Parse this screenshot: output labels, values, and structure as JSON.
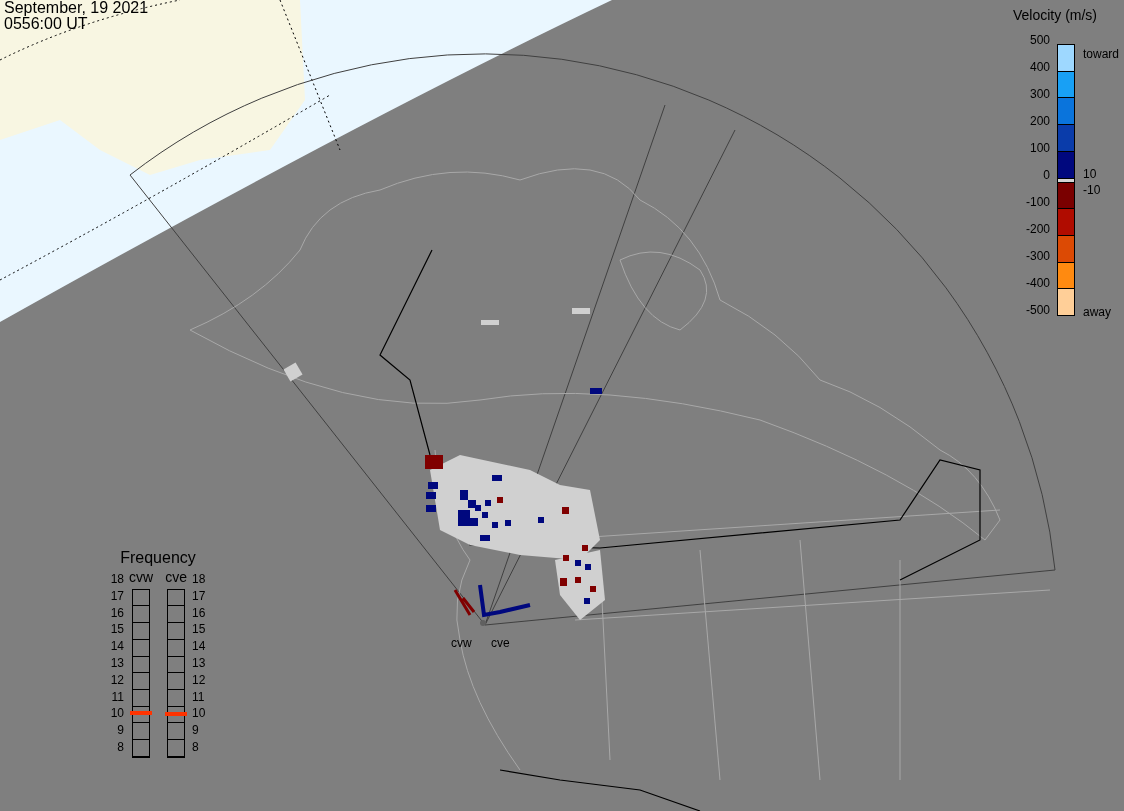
{
  "header": {
    "date": "September, 19 2021",
    "time": "0556:00 UT"
  },
  "velocity_legend": {
    "title": "Velocity (m/s)",
    "ticks": [
      "500",
      "400",
      "300",
      "200",
      "100",
      "0",
      "-100",
      "-200",
      "-300",
      "-400",
      "-500"
    ],
    "bands": [
      {
        "kind": "band",
        "color": "#9ed8ff"
      },
      {
        "kind": "band",
        "color": "#18a0f5"
      },
      {
        "kind": "band",
        "color": "#0a74dc"
      },
      {
        "kind": "band",
        "color": "#0a3caa"
      },
      {
        "kind": "band",
        "color": "#00087e"
      },
      {
        "kind": "zero",
        "color": "#d4d4d4"
      },
      {
        "kind": "band",
        "color": "#7a0000"
      },
      {
        "kind": "band",
        "color": "#b00c00"
      },
      {
        "kind": "band",
        "color": "#dc4a04"
      },
      {
        "kind": "band",
        "color": "#ff8a10"
      },
      {
        "kind": "band",
        "color": "#ffcf98"
      }
    ],
    "top_label": "toward",
    "upper_threshold": "10",
    "lower_threshold": "-10",
    "bottom_label": "away"
  },
  "frequency": {
    "title": "Frequency",
    "radars": [
      {
        "name": "cvw",
        "kind": "left",
        "scale": [
          "18",
          "17",
          "16",
          "15",
          "14",
          "13",
          "12",
          "11",
          "10",
          "9",
          "8"
        ],
        "level": 0.26
      },
      {
        "name": "cve",
        "kind": "right",
        "scale": [
          "18",
          "17",
          "16",
          "15",
          "14",
          "13",
          "12",
          "11",
          "10",
          "9",
          "8"
        ],
        "level": 0.255
      }
    ]
  },
  "map": {
    "site_labels": [
      "cvw",
      "cve"
    ]
  }
}
